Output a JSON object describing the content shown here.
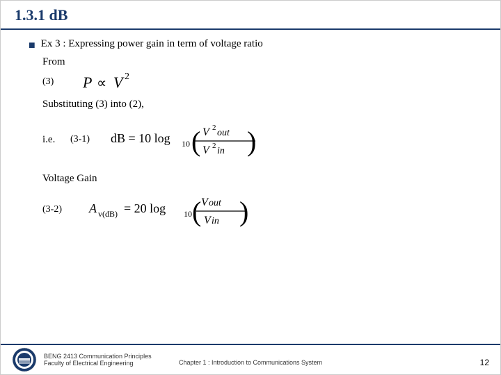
{
  "header": {
    "title": "1.3.1 dB"
  },
  "content": {
    "bullet": "n",
    "ex_text": "Ex 3 :  Expressing power gain in term of voltage ratio",
    "from_label": "From",
    "eq3_num": "(3)",
    "subst_text": "Substituting (3) into (2),",
    "ie_label": "i.e.",
    "eq31_num": "(3-1)",
    "vgain_label": "Voltage Gain",
    "eq32_num": "(3-2)"
  },
  "footer": {
    "line1": "BENG 2413 Communication Principles",
    "line2": "Faculty of Electrical Engineering",
    "chapter": "Chapter 1 : Introduction to Communications System",
    "page": "12"
  }
}
